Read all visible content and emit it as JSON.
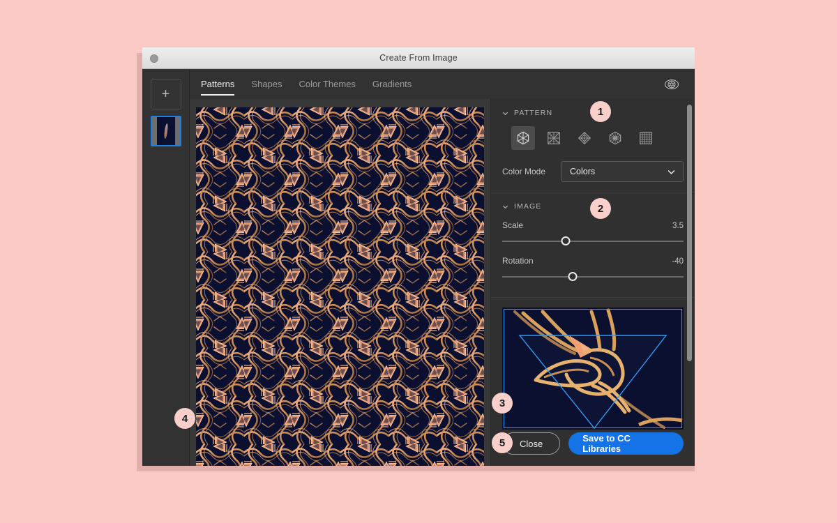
{
  "window": {
    "title": "Create From Image",
    "traffic_light": "close-button"
  },
  "rail": {
    "add_label": "+",
    "thumbnail_name": "source-image-thumbnail"
  },
  "tabs": [
    {
      "label": "Patterns",
      "active": true
    },
    {
      "label": "Shapes",
      "active": false
    },
    {
      "label": "Color Themes",
      "active": false
    },
    {
      "label": "Gradients",
      "active": false
    }
  ],
  "toolbar": {
    "preview_icon": "eye-preview-icon"
  },
  "pattern_section": {
    "title": "PATTERN",
    "types": [
      {
        "name": "hexagon-wedges",
        "selected": true
      },
      {
        "name": "square-grid-burst",
        "selected": false
      },
      {
        "name": "diamond-star",
        "selected": false
      },
      {
        "name": "hexagon-radial",
        "selected": false
      },
      {
        "name": "square-grid",
        "selected": false
      }
    ],
    "color_mode_label": "Color Mode",
    "color_mode_value": "Colors",
    "color_mode_options": [
      "Colors"
    ]
  },
  "image_section": {
    "title": "IMAGE",
    "scale": {
      "label": "Scale",
      "value": "3.5",
      "percent": 35
    },
    "rotation": {
      "label": "Rotation",
      "value": "-40",
      "percent": 39
    }
  },
  "footer": {
    "close_label": "Close",
    "save_label": "Save to CC Libraries"
  },
  "badges": [
    {
      "num": "1",
      "left": "846",
      "top": "145"
    },
    {
      "num": "2",
      "left": "846",
      "top": "284"
    },
    {
      "num": "3",
      "left": "705",
      "top": "563"
    },
    {
      "num": "4",
      "left": "250",
      "top": "585"
    },
    {
      "num": "5",
      "left": "705",
      "top": "620"
    }
  ],
  "colors": {
    "page_background": "#fbc9c5",
    "accent_blue": "#1473e6",
    "badge_pink": "#f9cfcb",
    "pattern_background": "#0b1030",
    "pattern_line": "#e8a97a",
    "selection_blue": "#1f7fe0"
  }
}
